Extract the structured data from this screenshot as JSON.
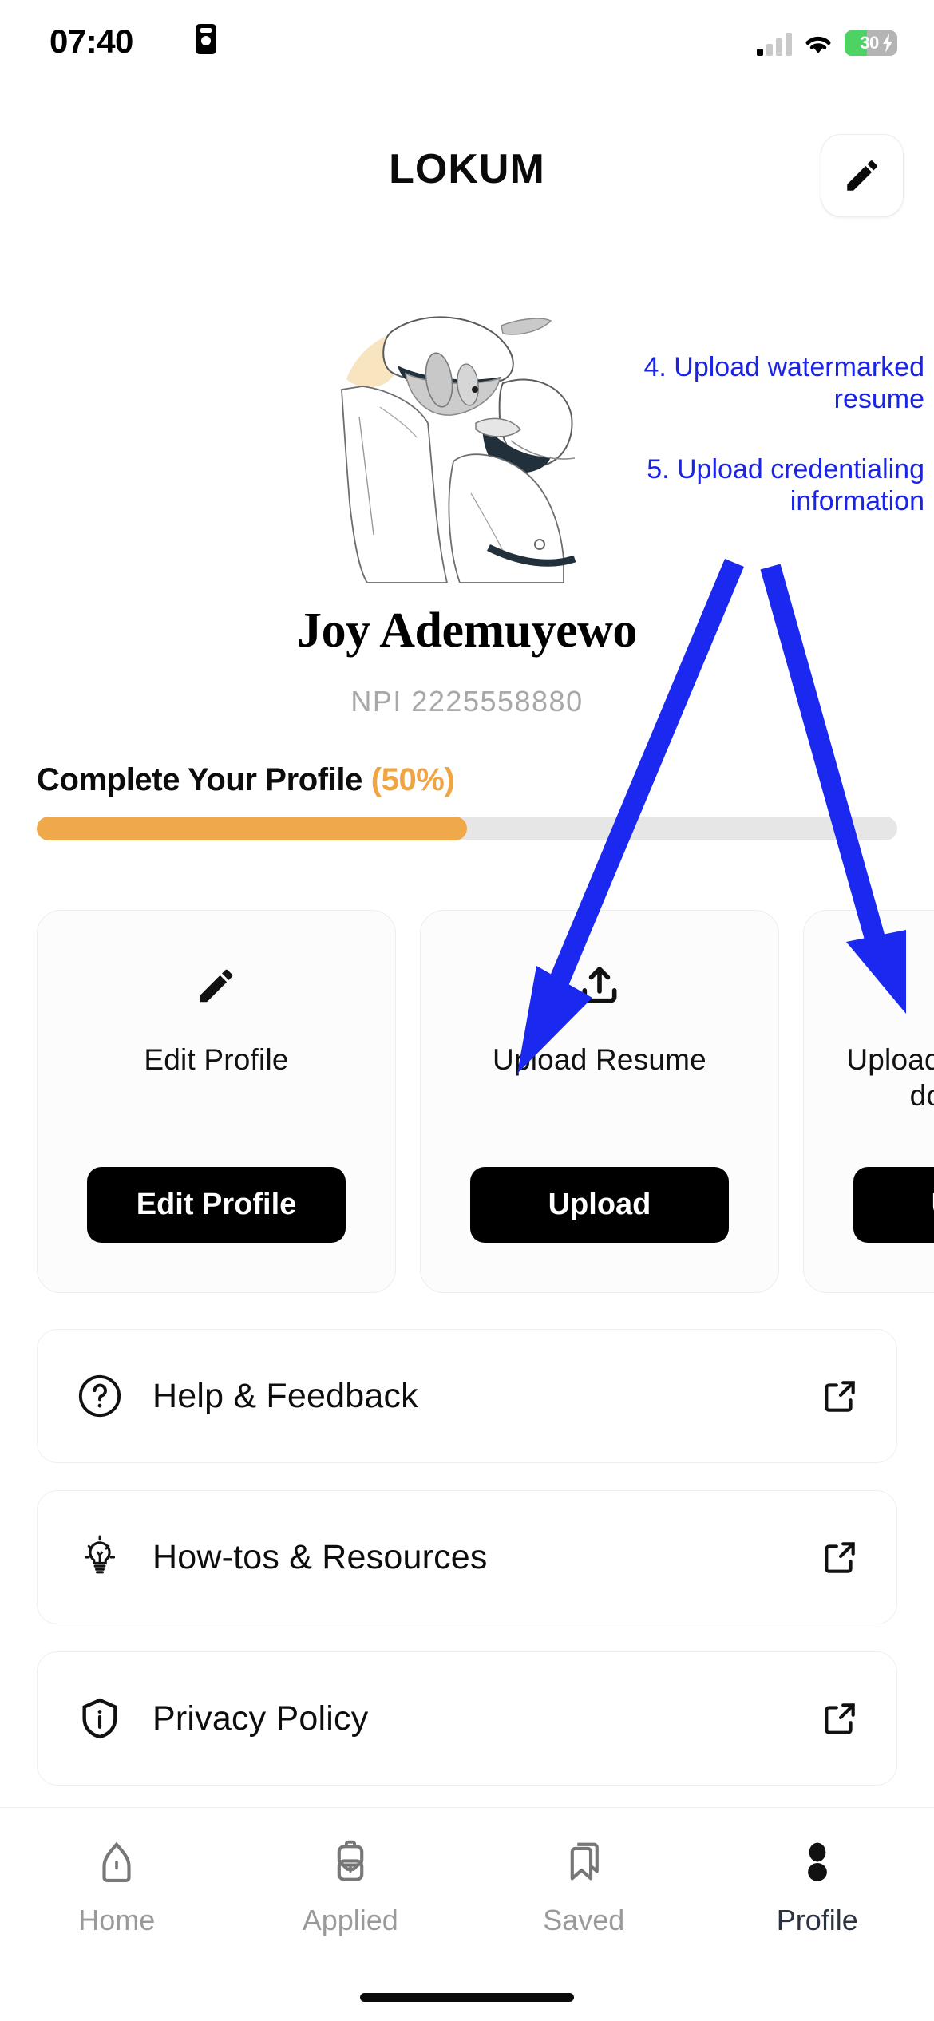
{
  "status_bar": {
    "time": "07:40",
    "time_icon": "id-card-icon",
    "signal_icon": "cellular-signal-icon",
    "wifi_icon": "wifi-icon",
    "battery_percent": "30",
    "battery_charging": true,
    "battery_color": "#4cd364"
  },
  "header": {
    "logo": "LOKUM",
    "edit_button_icon": "pencil-icon"
  },
  "illustration": {
    "name": "medical-professionals-line-art",
    "accent_color": "#f8e4bf"
  },
  "annotations": {
    "color": "#1a23e8",
    "items": [
      {
        "text": "4. Upload watermarked resume"
      },
      {
        "text": "5. Upload credentialing information"
      }
    ]
  },
  "profile": {
    "name": "Joy Ademuyewo",
    "npi": "NPI 2225558880"
  },
  "progress": {
    "label": "Complete Your Profile",
    "percent_label": "(50%)",
    "percent_value": 50,
    "fill_color": "#f0a94a",
    "track_color": "#e6e6e6"
  },
  "cards": [
    {
      "icon": "pencil-icon",
      "label": "Edit Profile",
      "button_label": "Edit Profile"
    },
    {
      "icon": "upload-icon",
      "label": "Upload Resume",
      "button_label": "Upload"
    },
    {
      "icon": "upload-icon",
      "label": "Upload credentialing documents",
      "button_label": "Upload"
    }
  ],
  "menu": [
    {
      "icon": "question-circle-icon",
      "label": "Help & Feedback",
      "action_icon": "external-link-icon"
    },
    {
      "icon": "lightbulb-icon",
      "label": "How-tos & Resources",
      "action_icon": "external-link-icon"
    },
    {
      "icon": "shield-info-icon",
      "label": "Privacy Policy",
      "action_icon": "external-link-icon"
    }
  ],
  "bottom_nav": {
    "items": [
      {
        "icon": "home-icon",
        "label": "Home",
        "active": false
      },
      {
        "icon": "briefcase-icon",
        "label": "Applied",
        "active": false
      },
      {
        "icon": "bookmark-icon",
        "label": "Saved",
        "active": false
      },
      {
        "icon": "person-icon",
        "label": "Profile",
        "active": true
      }
    ],
    "active_color": "#2b3340",
    "inactive_color": "#9a9a9a"
  }
}
